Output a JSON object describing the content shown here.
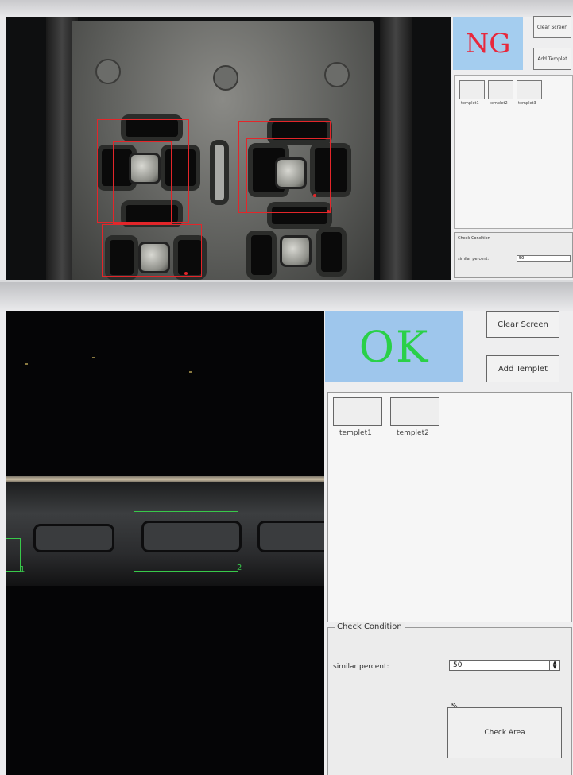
{
  "top": {
    "status": "NG",
    "buttons": {
      "clear_screen": "Clear Screen",
      "add_templet": "Add Templet"
    },
    "templets": [
      "templet1",
      "templet2",
      "templet3"
    ],
    "check_condition": {
      "title": "Check Condition",
      "similar_percent_label": "similar percent:",
      "similar_percent_value": "50"
    }
  },
  "bottom": {
    "status": "OK",
    "buttons": {
      "clear_screen": "Clear Screen",
      "add_templet": "Add Templet",
      "check_area": "Check Area"
    },
    "templets": [
      "templet1",
      "templet2"
    ],
    "check_condition": {
      "title": "Check Condition",
      "similar_percent_label": "similar percent:",
      "similar_percent_value": "50"
    },
    "match_labels": [
      "1",
      "2"
    ]
  },
  "colors": {
    "ng": "#e8283c",
    "ok": "#2ad048",
    "status_bg": "#a4cdef",
    "ng_box": "#e3262a",
    "ok_box": "#38c94a"
  },
  "icons": [
    "cursor-arrow-icon",
    "spinbox-arrows-icon"
  ]
}
